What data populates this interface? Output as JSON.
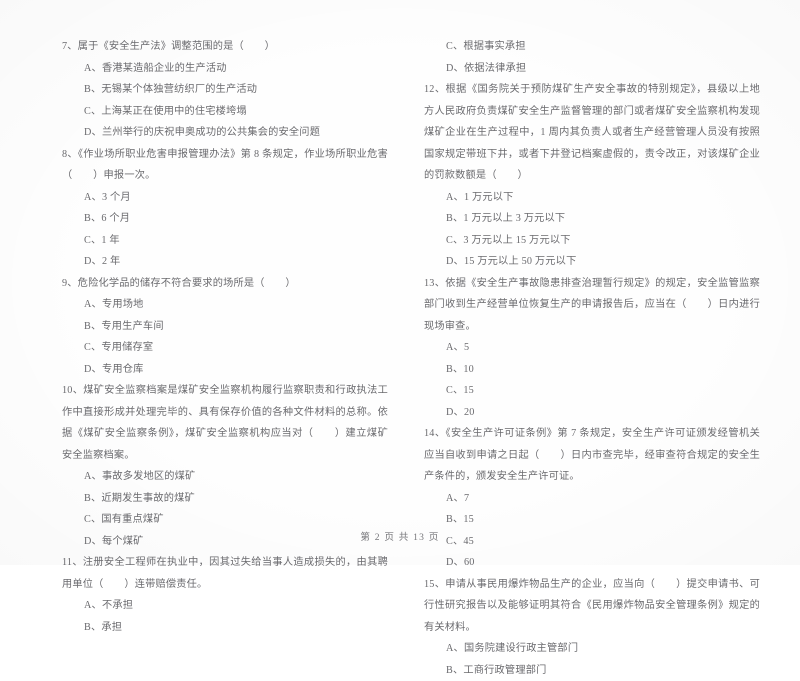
{
  "document": {
    "type": "exam-paper",
    "language": "zh-CN",
    "footer": "第 2 页 共 13 页"
  },
  "columns": {
    "left": [
      {
        "number": "7",
        "stem": "7、属于《安全生产法》调整范围的是（　　）",
        "options": [
          "A、香港某造船企业的生产活动",
          "B、无锡某个体独营纺织厂的生产活动",
          "C、上海某正在使用中的住宅楼垮塌",
          "D、兰州举行的庆祝申奥成功的公共集会的安全问题"
        ]
      },
      {
        "number": "8",
        "stem": "8、《作业场所职业危害申报管理办法》第 8 条规定，作业场所职业危害（　　）申报一次。",
        "options": [
          "A、3 个月",
          "B、6 个月",
          "C、1 年",
          "D、2 年"
        ]
      },
      {
        "number": "9",
        "stem": "9、危险化学品的储存不符合要求的场所是（　　）",
        "options": [
          "A、专用场地",
          "B、专用生产车间",
          "C、专用储存室",
          "D、专用仓库"
        ]
      },
      {
        "number": "10",
        "stem": "10、煤矿安全监察档案是煤矿安全监察机构履行监察职责和行政执法工作中直接形成并处理完毕的、具有保存价值的各种文件材料的总称。依据《煤矿安全监察条例》，煤矿安全监察机构应当对（　　）建立煤矿安全监察档案。",
        "options": [
          "A、事故多发地区的煤矿",
          "B、近期发生事故的煤矿",
          "C、国有重点煤矿",
          "D、每个煤矿"
        ]
      },
      {
        "number": "11",
        "stem": "11、注册安全工程师在执业中，因其过失给当事人造成损失的，由其聘用单位（　　）连带赔偿责任。",
        "options": [
          "A、不承担",
          "B、承担"
        ]
      }
    ],
    "right": [
      {
        "number": "11-cont",
        "stem": "",
        "options": [
          "C、根据事实承担",
          "D、依据法律承担"
        ]
      },
      {
        "number": "12",
        "stem": "12、根据《国务院关于预防煤矿生产安全事故的特别规定》，县级以上地方人民政府负责煤矿安全生产监督管理的部门或者煤矿安全监察机构发现煤矿企业在生产过程中，1 周内其负责人或者生产经营管理人员没有按照国家规定带班下井，或者下井登记档案虚假的，责令改正，对该煤矿企业的罚款数额是（　　）",
        "options": [
          "A、1 万元以下",
          "B、1 万元以上 3 万元以下",
          "C、3 万元以上 15 万元以下",
          "D、15 万元以上 50 万元以下"
        ]
      },
      {
        "number": "13",
        "stem": "13、依据《安全生产事故隐患排查治理暂行规定》的规定，安全监管监察部门收到生产经营单位恢复生产的申请报告后，应当在（　　）日内进行现场审查。",
        "options": [
          "A、5",
          "B、10",
          "C、15",
          "D、20"
        ]
      },
      {
        "number": "14",
        "stem": "14、《安全生产许可证条例》第 7 条规定，安全生产许可证颁发经管机关应当自收到申请之日起（　　）日内市查完毕，经审查符合规定的安全生产条件的，颁发安全生产许可证。",
        "options": [
          "A、7",
          "B、15",
          "C、45",
          "D、60"
        ]
      },
      {
        "number": "15",
        "stem": "15、申请从事民用爆炸物品生产的企业，应当向（　　）提交申请书、可行性研究报告以及能够证明其符合《民用爆炸物品安全管理条例》规定的有关材料。",
        "options": [
          "A、国务院建设行政主管部门",
          "B、工商行政管理部门"
        ]
      }
    ]
  }
}
